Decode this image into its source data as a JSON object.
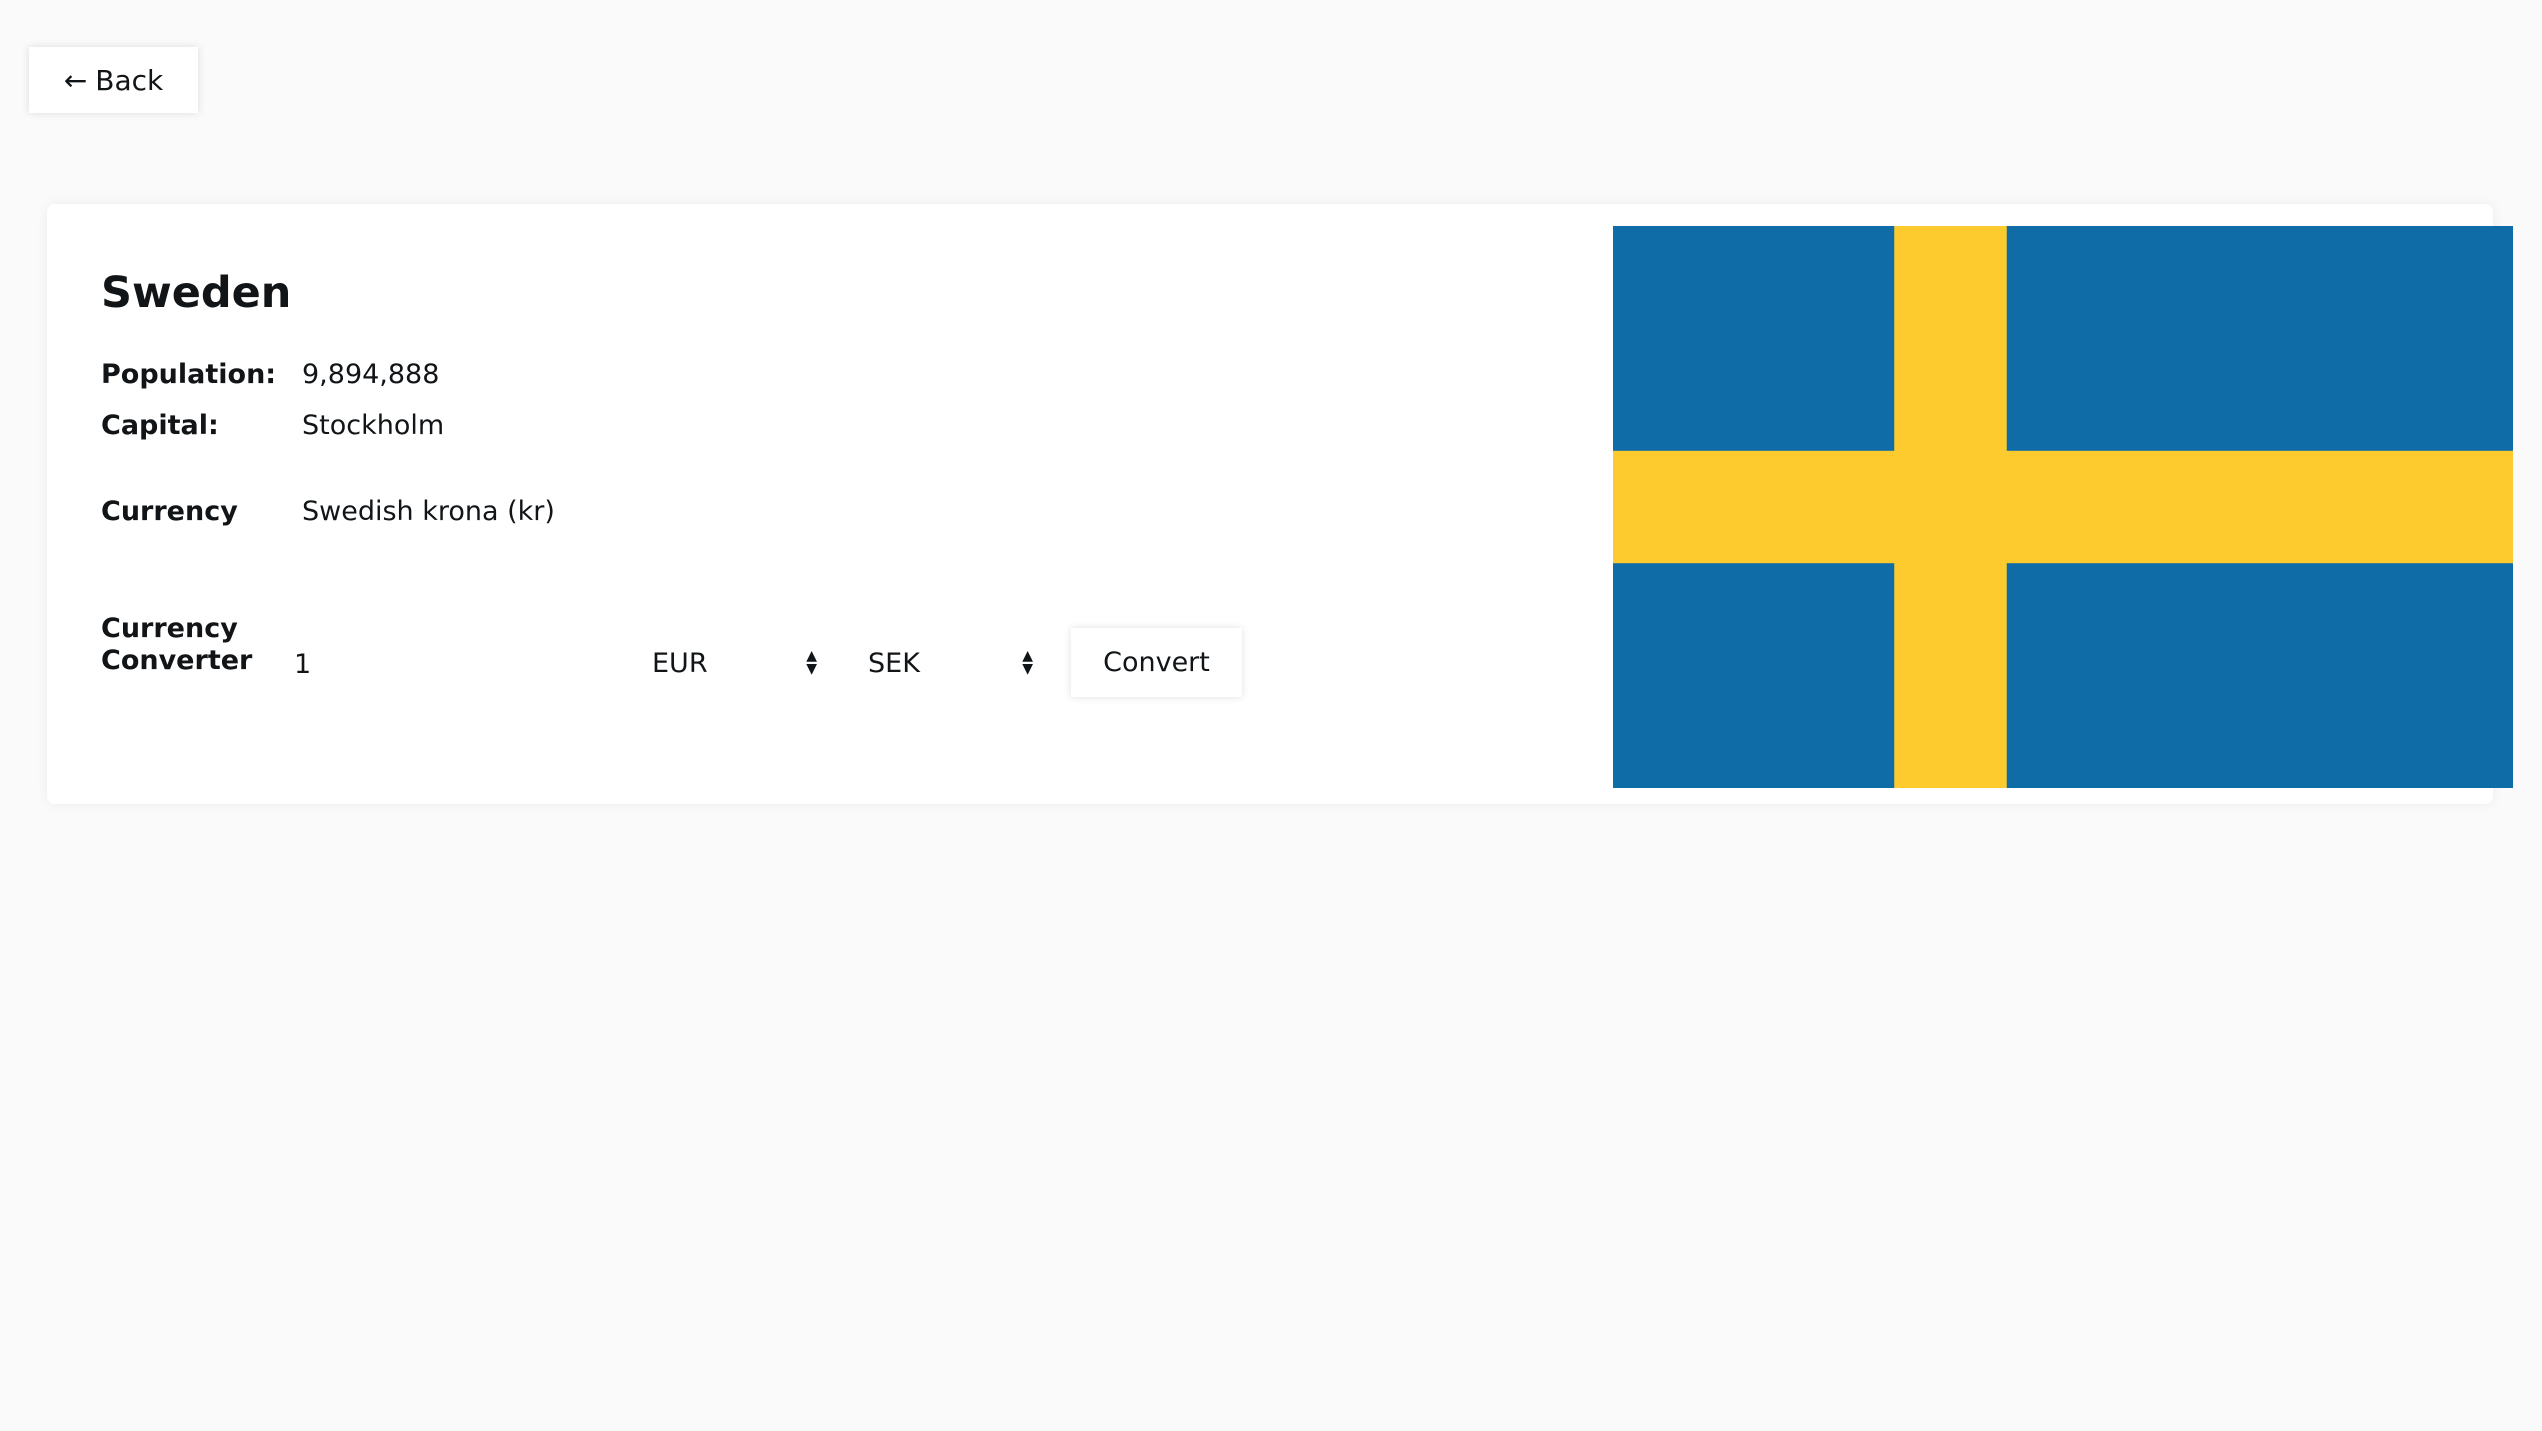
{
  "back_button": {
    "label": "Back",
    "icon": "arrow-left-icon"
  },
  "country": {
    "name": "Sweden",
    "population_label": "Population:",
    "population": "9,894,888",
    "capital_label": "Capital:",
    "capital": "Stockholm",
    "currency_label": "Currency",
    "currency": "Swedish krona (kr)"
  },
  "converter": {
    "label_line1": "Currency",
    "label_line2": "Converter",
    "amount": "1",
    "from": "EUR",
    "to": "SEK",
    "convert_label": "Convert"
  },
  "flag": {
    "blue": "#0f6ca6",
    "yellow": "#fdcb2e"
  }
}
